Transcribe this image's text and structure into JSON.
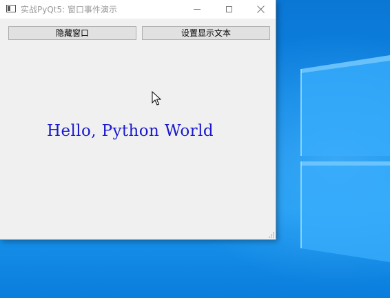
{
  "window": {
    "title": "实战PyQt5: 窗口事件演示"
  },
  "buttons": {
    "hide_window": "隐藏窗口",
    "set_text": "设置显示文本"
  },
  "label": {
    "text": "Hello, Python World"
  },
  "colors": {
    "label_text": "#1a1acc",
    "desktop": "#0a78d7"
  },
  "icons": {
    "app": "app-window-icon",
    "minimize": "minimize-icon",
    "maximize": "maximize-icon",
    "close": "close-icon",
    "cursor": "mouse-pointer-icon",
    "resize": "resize-grip-icon"
  }
}
